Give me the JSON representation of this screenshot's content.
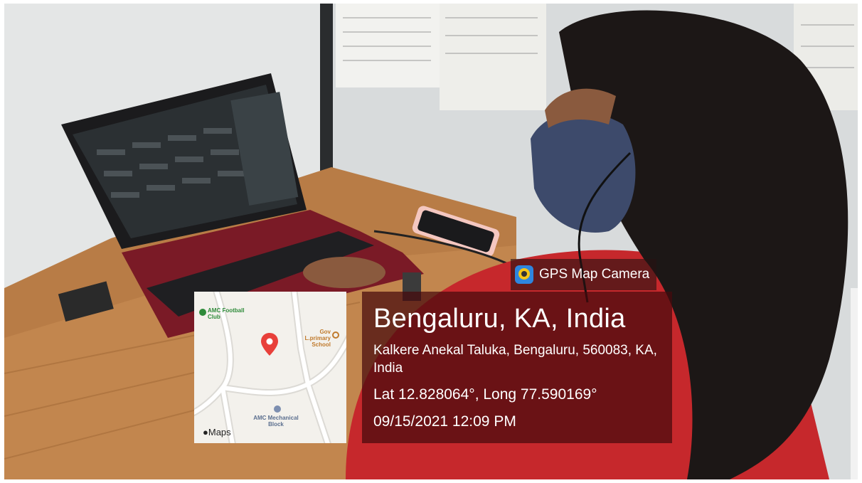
{
  "watermark": {
    "app_name": "GPS Map Camera",
    "app_icon": "gps-map-camera-icon",
    "city": "Bengaluru, KA, India",
    "address": "Kalkere Anekal Taluka, Bengaluru, 560083, KA, India",
    "coordinates": "Lat 12.828064°, Long 77.590169°",
    "datetime": "09/15/2021 12:09 PM"
  },
  "map": {
    "brand": "Maps",
    "brand_icon": "apple-logo-icon",
    "pin_icon": "map-pin-icon",
    "places": {
      "football_club": "AMC Football Club",
      "school": "Gov L.primary School",
      "mechanical_block": "AMC Mechanical Block"
    },
    "colors": {
      "pin": "#e8403a",
      "park": "#2e8b3a",
      "school": "#c07a2c"
    }
  }
}
